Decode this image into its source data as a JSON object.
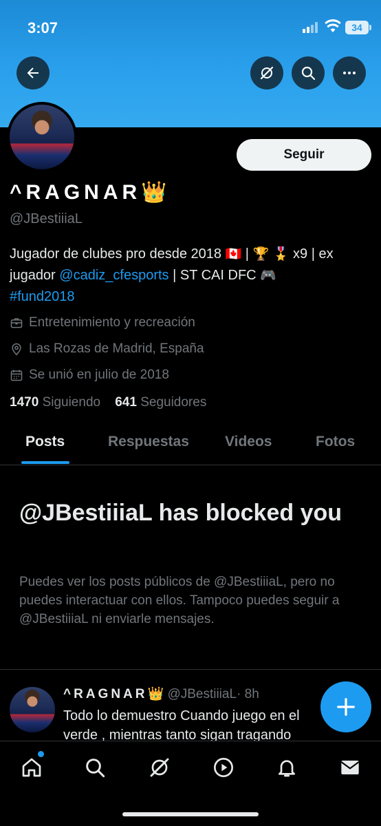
{
  "status_bar": {
    "time": "3:07",
    "battery": "34"
  },
  "header": {
    "icons": [
      "back-arrow-icon",
      "grok-icon",
      "search-icon",
      "more-icon"
    ]
  },
  "profile": {
    "display_name": "^RAGNAR",
    "crown_emoji": "👑",
    "handle": "@JBestiiiaL",
    "follow_label": "Seguir",
    "bio": {
      "line1": "Jugador de clubes pro desde 2018",
      "flag": "🇨🇦",
      "sep1": " | ",
      "trophy": "🏆",
      "medal": "🎖️",
      "x9": " x9 | ex",
      "line2_prefix": "jugador ",
      "mention": "@cadiz_cfesports",
      "line2_suffix": " | ST CAI DFC ",
      "gamepad": "🎮",
      "hashtag": "#fund2018"
    },
    "category": "Entretenimiento y recreación",
    "location": "Las Rozas de Madrid, España",
    "joined": "Se unió en julio de 2018",
    "following_count": "1470",
    "following_label": "Siguiendo",
    "followers_count": "641",
    "followers_label": "Seguidores"
  },
  "tabs": [
    {
      "label": "Posts",
      "active": true
    },
    {
      "label": "Respuestas",
      "active": false
    },
    {
      "label": "Videos",
      "active": false
    },
    {
      "label": "Fotos",
      "active": false
    }
  ],
  "blocked": {
    "title": "@JBestiiiaL has blocked you",
    "message": "Puedes ver los posts públicos de @JBestiiiaL, pero no puedes interactuar con ellos. Tampoco puedes seguir a @JBestiiiaL ni enviarle mensajes."
  },
  "post": {
    "name": "^RAGNAR",
    "crown": "👑",
    "handle": "@JBestiiiaL",
    "time": "· 8h",
    "text": "Todo lo demuestro Cuando juego en el verde , mientras tanto sigan tragando"
  },
  "bottom_nav": [
    "home-icon",
    "search-icon",
    "grok-icon",
    "play-icon",
    "bell-icon",
    "mail-icon"
  ],
  "colors": {
    "accent": "#1d9bf0",
    "banner": "#2aa0ec",
    "background": "#000000",
    "muted": "#71767b"
  }
}
